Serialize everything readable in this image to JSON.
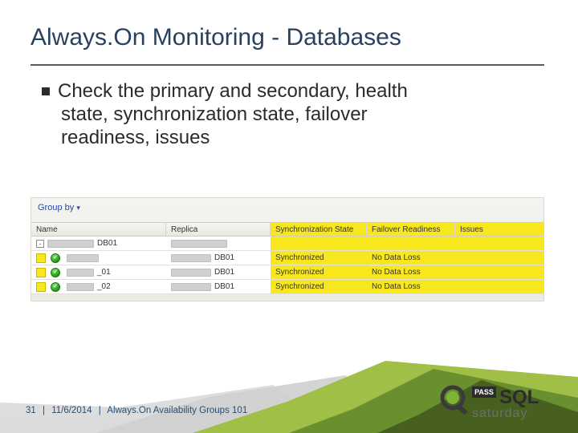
{
  "title": "Always.On Monitoring - Databases",
  "bullet": {
    "line1": "Check the primary and secondary, health",
    "line2": "state, synchronization state, failover",
    "line3": "readiness, issues"
  },
  "screenshot": {
    "group_by": "Group by",
    "chevron": "▾",
    "headers": {
      "name": "Name",
      "replica": "Replica",
      "sync": "Synchronization State",
      "failover": "Failover Readiness",
      "issues": "Issues"
    },
    "rows": [
      {
        "name_suffix": "DB01",
        "replica_suffix": "",
        "sync": "",
        "fail": "",
        "issues": ""
      },
      {
        "name_suffix": "",
        "replica_suffix": "DB01",
        "sync": "Synchronized",
        "fail": "No Data Loss",
        "issues": ""
      },
      {
        "name_suffix": "_01",
        "replica_suffix": "DB01",
        "sync": "Synchronized",
        "fail": "No Data Loss",
        "issues": ""
      },
      {
        "name_suffix": "_02",
        "replica_suffix": "DB01",
        "sync": "Synchronized",
        "fail": "No Data Loss",
        "issues": ""
      }
    ]
  },
  "footer": {
    "page": "31",
    "date": "11/6/2014",
    "topic": "Always.On Availability Groups 101"
  },
  "logo": {
    "pass": "PASS",
    "sql": "SQL",
    "saturday": "saturday"
  }
}
